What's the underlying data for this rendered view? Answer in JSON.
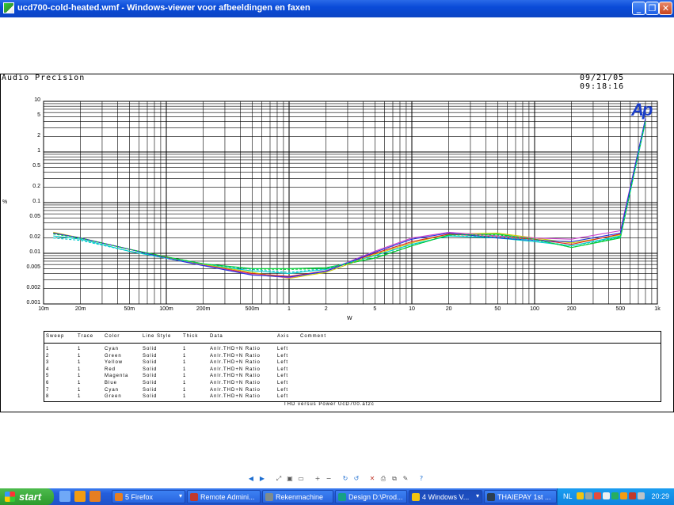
{
  "window": {
    "title": "ucd700-cold-heated.wmf - Windows-viewer voor afbeeldingen en faxen",
    "minimize_label": "_",
    "maximize_label": "❐",
    "close_label": "✕"
  },
  "plot": {
    "brand": "Audio Precision",
    "timestamp": "09/21/05 09:18:16",
    "logo_text": "Ap",
    "caption": "THD versus Power UcD700.at2c"
  },
  "chart_data": {
    "type": "line",
    "x_scale": "log",
    "y_scale": "log",
    "xlim": [
      0.01,
      1000
    ],
    "ylim": [
      0.001,
      10
    ],
    "xlabel": "W",
    "ylabel": "%",
    "x_ticks": [
      {
        "v": 0.01,
        "label": "10m"
      },
      {
        "v": 0.02,
        "label": "20m"
      },
      {
        "v": 0.05,
        "label": "50m"
      },
      {
        "v": 0.1,
        "label": "100m"
      },
      {
        "v": 0.2,
        "label": "200m"
      },
      {
        "v": 0.5,
        "label": "500m"
      },
      {
        "v": 1,
        "label": "1"
      },
      {
        "v": 2,
        "label": "2"
      },
      {
        "v": 5,
        "label": "5"
      },
      {
        "v": 10,
        "label": "10"
      },
      {
        "v": 20,
        "label": "20"
      },
      {
        "v": 50,
        "label": "50"
      },
      {
        "v": 100,
        "label": "100"
      },
      {
        "v": 200,
        "label": "200"
      },
      {
        "v": 500,
        "label": "500"
      },
      {
        "v": 1000,
        "label": "1k"
      }
    ],
    "y_ticks": [
      {
        "v": 10,
        "label": "10"
      },
      {
        "v": 5,
        "label": "5"
      },
      {
        "v": 2,
        "label": "2"
      },
      {
        "v": 1,
        "label": "1"
      },
      {
        "v": 0.5,
        "label": "0.5"
      },
      {
        "v": 0.2,
        "label": "0.2"
      },
      {
        "v": 0.1,
        "label": "0.1"
      },
      {
        "v": 0.05,
        "label": "0.05"
      },
      {
        "v": 0.02,
        "label": "0.02"
      },
      {
        "v": 0.01,
        "label": "0.01"
      },
      {
        "v": 0.005,
        "label": "0.005"
      },
      {
        "v": 0.002,
        "label": "0.002"
      },
      {
        "v": 0.001,
        "label": "0.001"
      }
    ],
    "grid": true,
    "series": [
      {
        "color": "#00cccc",
        "dash": "",
        "x": [
          0.012,
          0.02,
          0.05,
          0.1,
          0.2,
          0.5,
          1,
          2,
          5,
          10,
          20,
          50,
          100,
          200,
          500,
          800
        ],
        "y": [
          0.022,
          0.019,
          0.011,
          0.008,
          0.006,
          0.0045,
          0.004,
          0.0048,
          0.009,
          0.015,
          0.022,
          0.02,
          0.017,
          0.014,
          0.022,
          4.0
        ]
      },
      {
        "color": "#00cc33",
        "dash": "",
        "x": [
          0.012,
          0.02,
          0.05,
          0.1,
          0.2,
          0.5,
          1,
          2,
          5,
          10,
          20,
          50,
          100,
          200,
          500,
          800
        ],
        "y": [
          0.025,
          0.02,
          0.012,
          0.0085,
          0.0062,
          0.005,
          0.005,
          0.0052,
          0.008,
          0.014,
          0.023,
          0.024,
          0.019,
          0.013,
          0.02,
          4.2
        ]
      },
      {
        "color": "#cccc00",
        "dash": "",
        "x": [
          0.012,
          0.02,
          0.05,
          0.1,
          0.2,
          0.5,
          1,
          2,
          5,
          10,
          20,
          50,
          100,
          200,
          500,
          800
        ],
        "y": [
          0.026,
          0.02,
          0.012,
          0.008,
          0.006,
          0.0042,
          0.0032,
          0.0042,
          0.0095,
          0.016,
          0.024,
          0.025,
          0.02,
          0.016,
          0.023,
          4.3
        ]
      },
      {
        "color": "#dd2222",
        "dash": "",
        "x": [
          0.012,
          0.02,
          0.05,
          0.1,
          0.2,
          0.5,
          1,
          2,
          5,
          10,
          20,
          50,
          100,
          200,
          500,
          800
        ],
        "y": [
          0.025,
          0.02,
          0.012,
          0.0082,
          0.0058,
          0.004,
          0.0035,
          0.0045,
          0.01,
          0.017,
          0.024,
          0.021,
          0.019,
          0.015,
          0.024,
          4.4
        ]
      },
      {
        "color": "#cc44cc",
        "dash": "",
        "x": [
          0.012,
          0.02,
          0.05,
          0.1,
          0.2,
          0.5,
          1,
          2,
          5,
          10,
          20,
          50,
          100,
          200,
          500,
          800
        ],
        "y": [
          0.025,
          0.02,
          0.012,
          0.008,
          0.0058,
          0.0038,
          0.0033,
          0.0045,
          0.011,
          0.02,
          0.026,
          0.022,
          0.02,
          0.019,
          0.028,
          4.5
        ]
      },
      {
        "color": "#2233dd",
        "dash": "",
        "x": [
          0.012,
          0.02,
          0.05,
          0.1,
          0.2,
          0.5,
          1,
          2,
          5,
          10,
          20,
          50,
          100,
          200,
          500,
          800
        ],
        "y": [
          0.025,
          0.02,
          0.012,
          0.008,
          0.0057,
          0.0037,
          0.0034,
          0.0044,
          0.0105,
          0.019,
          0.025,
          0.02,
          0.018,
          0.017,
          0.025,
          4.6
        ]
      },
      {
        "color": "#00cccc",
        "dash": "3,2",
        "x": [
          0.012,
          0.02,
          0.05,
          0.1,
          0.2,
          0.5,
          1,
          2,
          5,
          10,
          20,
          50,
          100,
          200,
          500,
          800
        ],
        "y": [
          0.02,
          0.018,
          0.011,
          0.008,
          0.0062,
          0.0048,
          0.0042,
          0.005,
          0.009,
          0.015,
          0.022,
          0.021,
          0.018,
          0.014,
          0.021,
          3.9
        ]
      },
      {
        "color": "#00cc33",
        "dash": "3,2",
        "x": [
          0.012,
          0.02,
          0.05,
          0.1,
          0.2,
          0.5,
          1,
          2,
          5,
          10,
          20,
          50,
          100,
          200,
          500,
          800
        ],
        "y": [
          0.024,
          0.02,
          0.012,
          0.0085,
          0.0062,
          0.0049,
          0.0048,
          0.005,
          0.0082,
          0.014,
          0.023,
          0.023,
          0.019,
          0.013,
          0.021,
          4.1
        ]
      }
    ]
  },
  "legend": {
    "headers": [
      "Sweep",
      "Trace",
      "Color",
      "Line Style",
      "Thick",
      "Data",
      "Axis",
      "Comment"
    ],
    "rows": [
      [
        "1",
        "1",
        "Cyan",
        "Solid",
        "1",
        "Anlr.THD+N Ratio",
        "Left",
        ""
      ],
      [
        "2",
        "1",
        "Green",
        "Solid",
        "1",
        "Anlr.THD+N Ratio",
        "Left",
        ""
      ],
      [
        "3",
        "1",
        "Yellow",
        "Solid",
        "1",
        "Anlr.THD+N Ratio",
        "Left",
        ""
      ],
      [
        "4",
        "1",
        "Red",
        "Solid",
        "1",
        "Anlr.THD+N Ratio",
        "Left",
        ""
      ],
      [
        "5",
        "1",
        "Magenta",
        "Solid",
        "1",
        "Anlr.THD+N Ratio",
        "Left",
        ""
      ],
      [
        "6",
        "1",
        "Blue",
        "Solid",
        "1",
        "Anlr.THD+N Ratio",
        "Left",
        ""
      ],
      [
        "7",
        "1",
        "Cyan",
        "Solid",
        "1",
        "Anlr.THD+N Ratio",
        "Left",
        ""
      ],
      [
        "8",
        "1",
        "Green",
        "Solid",
        "1",
        "Anlr.THD+N Ratio",
        "Left",
        ""
      ]
    ]
  },
  "toolbar": {
    "icons": [
      "prev-image-icon",
      "next-image-icon",
      "best-fit-icon",
      "actual-size-icon",
      "slideshow-icon",
      "zoom-in-icon",
      "zoom-out-icon",
      "rotate-clockwise-icon",
      "rotate-counterclockwise-icon",
      "delete-icon",
      "print-icon",
      "copy-to-icon",
      "open-editor-icon",
      "help-icon"
    ]
  },
  "taskbar": {
    "start_label": "start",
    "quicklaunch": [
      "show-desktop-icon",
      "outlook-icon",
      "firefox-icon"
    ],
    "tasks": [
      {
        "label": "5 Firefox",
        "dropdown": true,
        "icon_color": "#e67e22",
        "active": false
      },
      {
        "label": "Remote Admini...",
        "dropdown": false,
        "icon_color": "#c0392b",
        "active": false
      },
      {
        "label": "Rekenmachine",
        "dropdown": false,
        "icon_color": "#7f8c8d",
        "active": false
      },
      {
        "label": "Design D:\\Prod...",
        "dropdown": false,
        "icon_color": "#16a085",
        "active": false
      },
      {
        "label": "4 Windows V...",
        "dropdown": true,
        "icon_color": "#f1c40f",
        "active": true
      },
      {
        "label": "THAIEPAY 1st ...",
        "dropdown": false,
        "icon_color": "#2c3e50",
        "active": false
      }
    ],
    "tray": {
      "language": "NL",
      "clock": "20:29",
      "icons": [
        "mail-icon",
        "network-icon",
        "security-icon",
        "volume-icon",
        "msn-icon",
        "update-icon",
        "antivirus-icon",
        "connection-icon"
      ]
    }
  }
}
